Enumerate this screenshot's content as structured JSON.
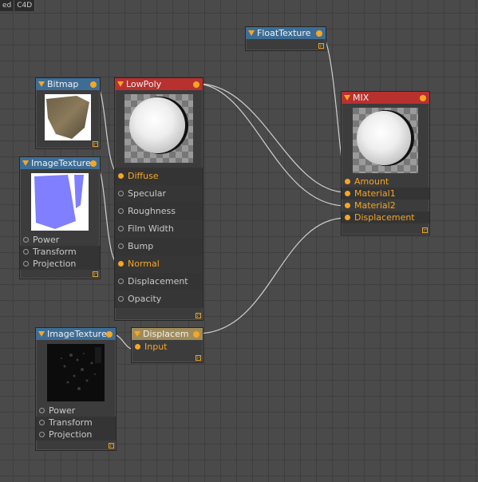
{
  "tabs": [
    "ed",
    "C4D"
  ],
  "nodes": {
    "floattexture": {
      "title": "FloatTexture"
    },
    "bitmap": {
      "title": "Bitmap"
    },
    "imagetexture1": {
      "title": "ImageTexture",
      "inputs": [
        "Power",
        "Transform",
        "Projection"
      ]
    },
    "lowpoly": {
      "title": "LowPoly",
      "inputs": [
        "Diffuse",
        "Specular",
        "Roughness",
        "Film Width",
        "Bump",
        "Normal",
        "Displacement",
        "Opacity"
      ]
    },
    "mix": {
      "title": "MIX",
      "inputs": [
        "Amount",
        "Material1",
        "Material2",
        "Displacement"
      ]
    },
    "displacement": {
      "title": "Displacem",
      "inputs": [
        "Input"
      ]
    },
    "imagetexture2": {
      "title": "ImageTexture",
      "inputs": [
        "Power",
        "Transform",
        "Projection"
      ]
    }
  },
  "colors": {
    "accent": "#f5a623",
    "texture_header": "#3d6d95",
    "material_header": "#b8312f",
    "displacement_header": "#a08c5a",
    "wire": "#cfcfcf"
  },
  "icons": {
    "collapse": "collapse-triangle-icon",
    "resize": "resize-grip-icon"
  }
}
